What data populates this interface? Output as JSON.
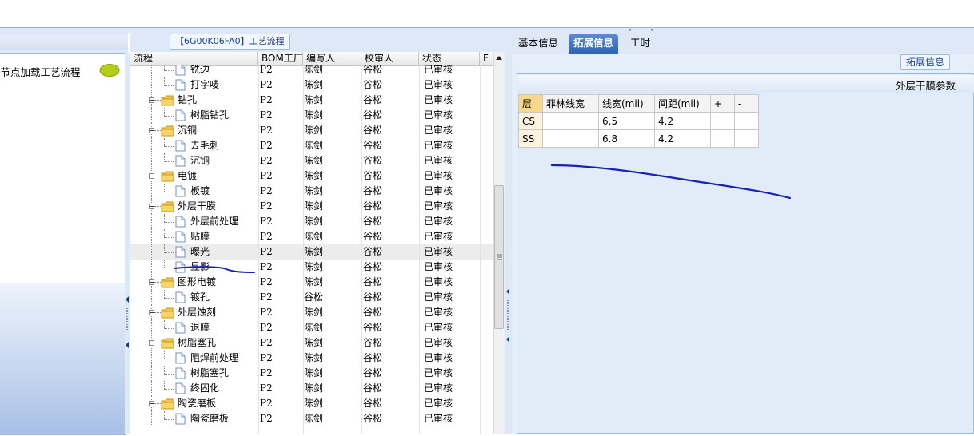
{
  "left": {
    "title": "结节点加载工艺流程"
  },
  "tree": {
    "title": "【6G00K06FA0】工艺流程",
    "columns": [
      "流程",
      "BOM工厂",
      "编写人",
      "校审人",
      "状态",
      "F"
    ],
    "rows": [
      {
        "name": "铣边",
        "level": 2,
        "bom": "P2",
        "author": "陈剑",
        "reviewer": "谷松",
        "status": "已审核"
      },
      {
        "name": "打字唛",
        "level": 2,
        "bom": "P2",
        "author": "陈剑",
        "reviewer": "谷松",
        "status": "已审核"
      },
      {
        "name": "钻孔",
        "level": 1,
        "bom": "P2",
        "author": "陈剑",
        "reviewer": "谷松",
        "status": "已审核"
      },
      {
        "name": "树脂钻孔",
        "level": 2,
        "bom": "P2",
        "author": "陈剑",
        "reviewer": "谷松",
        "status": "已审核"
      },
      {
        "name": "沉铜",
        "level": 1,
        "bom": "P2",
        "author": "陈剑",
        "reviewer": "谷松",
        "status": "已审核"
      },
      {
        "name": "去毛刺",
        "level": 2,
        "bom": "P2",
        "author": "陈剑",
        "reviewer": "谷松",
        "status": "已审核"
      },
      {
        "name": "沉铜",
        "level": 2,
        "bom": "P2",
        "author": "陈剑",
        "reviewer": "谷松",
        "status": "已审核"
      },
      {
        "name": "电镀",
        "level": 1,
        "bom": "P2",
        "author": "陈剑",
        "reviewer": "谷松",
        "status": "已审核"
      },
      {
        "name": "板镀",
        "level": 2,
        "bom": "P2",
        "author": "陈剑",
        "reviewer": "谷松",
        "status": "已审核"
      },
      {
        "name": "外层干膜",
        "level": 1,
        "bom": "P2",
        "author": "陈剑",
        "reviewer": "谷松",
        "status": "已审核"
      },
      {
        "name": "外层前处理",
        "level": 2,
        "bom": "P2",
        "author": "陈剑",
        "reviewer": "谷松",
        "status": "已审核"
      },
      {
        "name": "贴膜",
        "level": 2,
        "bom": "P2",
        "author": "陈剑",
        "reviewer": "谷松",
        "status": "已审核"
      },
      {
        "name": "曝光",
        "level": 2,
        "bom": "P2",
        "author": "陈剑",
        "reviewer": "谷松",
        "status": "已审核",
        "selected": true
      },
      {
        "name": "显影",
        "level": 2,
        "bom": "P2",
        "author": "陈剑",
        "reviewer": "谷松",
        "status": "已审核"
      },
      {
        "name": "图形电镀",
        "level": 1,
        "bom": "P2",
        "author": "陈剑",
        "reviewer": "谷松",
        "status": "已审核"
      },
      {
        "name": "镀孔",
        "level": 2,
        "bom": "P2",
        "author": "谷松",
        "reviewer": "谷松",
        "status": "已审核"
      },
      {
        "name": "外层蚀刻",
        "level": 1,
        "bom": "P2",
        "author": "陈剑",
        "reviewer": "谷松",
        "status": "已审核"
      },
      {
        "name": "退膜",
        "level": 2,
        "bom": "P2",
        "author": "陈剑",
        "reviewer": "谷松",
        "status": "已审核"
      },
      {
        "name": "树脂塞孔",
        "level": 1,
        "bom": "P2",
        "author": "陈剑",
        "reviewer": "谷松",
        "status": "已审核"
      },
      {
        "name": "阻焊前处理",
        "level": 2,
        "bom": "P2",
        "author": "陈剑",
        "reviewer": "谷松",
        "status": "已审核"
      },
      {
        "name": "树脂塞孔",
        "level": 2,
        "bom": "P2",
        "author": "陈剑",
        "reviewer": "谷松",
        "status": "已审核"
      },
      {
        "name": "终固化",
        "level": 2,
        "bom": "P2",
        "author": "陈剑",
        "reviewer": "谷松",
        "status": "已审核"
      },
      {
        "name": "陶瓷磨板",
        "level": 1,
        "bom": "P2",
        "author": "陈剑",
        "reviewer": "谷松",
        "status": "已审核"
      },
      {
        "name": "陶瓷磨板",
        "level": 2,
        "bom": "P2",
        "author": "陈剑",
        "reviewer": "谷松",
        "status": "已审核"
      }
    ]
  },
  "right": {
    "tabs": [
      {
        "label": "基本信息",
        "active": false
      },
      {
        "label": "拓展信息",
        "active": true
      },
      {
        "label": "工时",
        "active": false
      }
    ],
    "section_tab": "拓展信息",
    "frame_title": "外层干膜参数",
    "param_table": {
      "headers": [
        "层",
        "菲林线宽",
        "线宽(mil)",
        "间距(mil)",
        "+",
        "-"
      ],
      "rows": [
        [
          "CS",
          "",
          "6.5",
          "4.2",
          "",
          ""
        ],
        [
          "SS",
          "",
          "6.8",
          "4.2",
          "",
          ""
        ]
      ]
    }
  },
  "colors": {
    "accent": "#2d62b6",
    "panel_bg": "#dfe8f6",
    "border": "#99bbe8",
    "annotation_pen": "#1a22b0"
  }
}
